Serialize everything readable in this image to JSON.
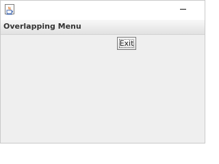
{
  "window": {
    "icon": "java-coffee-cup-icon",
    "controls": {
      "minimize_icon": "minimize-icon"
    }
  },
  "menubar": {
    "title": "Overlapping Menu"
  },
  "content": {
    "exit_button_label": "Exit"
  },
  "colors": {
    "window_background": "#eeeeee",
    "titlebar_background": "#ffffff",
    "menubar_gradient_top": "#f8f8f8",
    "menubar_gradient_bottom": "#e1e1e1"
  }
}
